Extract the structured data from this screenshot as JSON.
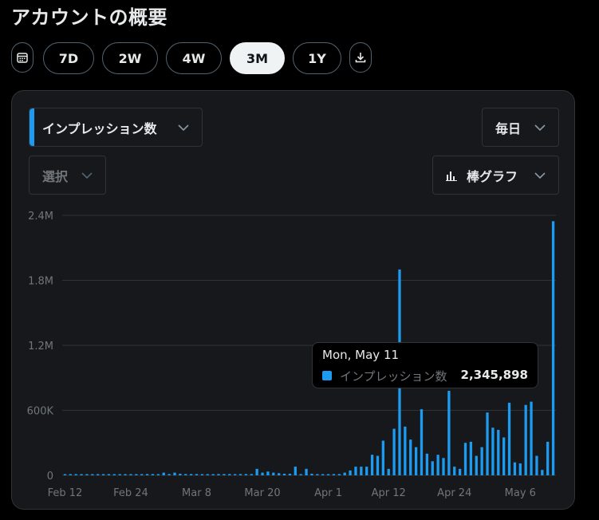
{
  "page": {
    "title": "アカウントの概要"
  },
  "range_buttons": [
    {
      "label": "7D",
      "active": false
    },
    {
      "label": "2W",
      "active": false
    },
    {
      "label": "4W",
      "active": false
    },
    {
      "label": "3M",
      "active": true
    },
    {
      "label": "1Y",
      "active": false
    }
  ],
  "controls": {
    "metric_select": "インプレッション数",
    "compare_select": "選択",
    "interval_select": "毎日",
    "chart_type_select": "棒グラフ",
    "calendar_icon": "calendar-icon",
    "download_icon": "download-icon"
  },
  "tooltip": {
    "date": "Mon, May 11",
    "series_label": "インプレッション数",
    "value": "2,345,898"
  },
  "colors": {
    "accent": "#1d9bf0",
    "grid": "#2f3336",
    "axis_text": "#71767b",
    "background": "#16181c"
  },
  "chart_data": {
    "type": "bar",
    "ylim": [
      0,
      2400000
    ],
    "yticks": [
      0,
      600000,
      1200000,
      1800000,
      2400000
    ],
    "ytick_labels": [
      "0",
      "600K",
      "1.2M",
      "1.8M",
      "2.4M"
    ],
    "xtick_labels": [
      "Feb 12",
      "Feb 24",
      "Mar 8",
      "Mar 20",
      "Apr 1",
      "Apr 12",
      "Apr 24",
      "May 6"
    ],
    "xtick_index": [
      0,
      12,
      24,
      36,
      48,
      59,
      71,
      83
    ],
    "grid": true,
    "series": [
      {
        "values": [
          5000,
          5000,
          5000,
          6000,
          5000,
          5000,
          5000,
          6000,
          5000,
          5000,
          5000,
          6000,
          10000,
          10000,
          10000,
          12000,
          12000,
          10000,
          25000,
          12000,
          25000,
          15000,
          12000,
          12000,
          12000,
          10000,
          10000,
          10000,
          12000,
          12000,
          12000,
          10000,
          12000,
          12000,
          12000,
          60000,
          25000,
          35000,
          25000,
          20000,
          15000,
          15000,
          80000,
          10000,
          60000,
          15000,
          10000,
          10000,
          10000,
          12000,
          12000,
          25000,
          45000,
          80000,
          80000,
          80000,
          190000,
          180000,
          320000,
          60000,
          430000,
          1900000,
          450000,
          330000,
          260000,
          610000,
          200000,
          130000,
          190000,
          160000,
          780000,
          80000,
          60000,
          300000,
          310000,
          180000,
          260000,
          580000,
          440000,
          420000,
          350000,
          670000,
          120000,
          110000,
          650000,
          680000,
          180000,
          50000,
          310000,
          2345898
        ]
      }
    ]
  }
}
